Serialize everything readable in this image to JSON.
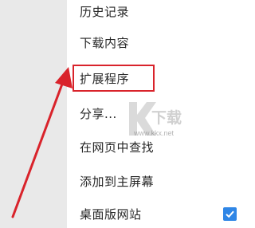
{
  "menu": {
    "items": [
      {
        "label": "历史记录"
      },
      {
        "label": "下载内容"
      },
      {
        "label": "扩展程序"
      },
      {
        "label": "分享..."
      },
      {
        "label": "在网页中查找"
      },
      {
        "label": "添加到主屏幕"
      },
      {
        "label": "桌面版网站",
        "checked": true
      }
    ]
  },
  "watermark": {
    "text": "下载",
    "url": "www.kkx.net"
  },
  "colors": {
    "highlight": "#d9232b",
    "checkbox": "#2f86e6",
    "text": "#262626"
  }
}
